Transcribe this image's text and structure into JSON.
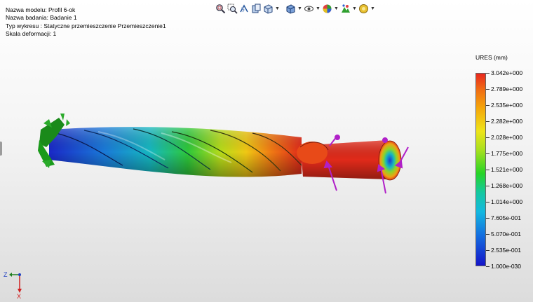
{
  "info": {
    "model_name": "Nazwa modelu: Profil 6-ok",
    "study_name": "Nazwa badania: Badanie 1",
    "plot_type": "Typ wykresu : Statyczne przemieszczenie Przemieszczenie1",
    "deformation_scale": "Skala deformacji: 1"
  },
  "toolbar": {
    "icons": [
      "zoom-to-fit-icon",
      "zoom-to-area-icon",
      "previous-view-icon",
      "section-view-icon",
      "view-orientation-icon",
      "display-style-icon",
      "hide-show-items-icon",
      "edit-appearance-icon",
      "apply-scene-icon",
      "view-settings-icon"
    ]
  },
  "legend": {
    "title": "URES (mm)",
    "labels": [
      "3.042e+000",
      "2.789e+000",
      "2.535e+000",
      "2.282e+000",
      "2.028e+000",
      "1.775e+000",
      "1.521e+000",
      "1.268e+000",
      "1.014e+000",
      "7.605e-001",
      "5.070e-001",
      "2.535e-001",
      "1.000e-030"
    ],
    "colors": {
      "max": "#e8281e",
      "mid": "#26d426",
      "min": "#1414c8"
    }
  },
  "triad": {
    "x_label": "X",
    "z_label": "Z"
  }
}
